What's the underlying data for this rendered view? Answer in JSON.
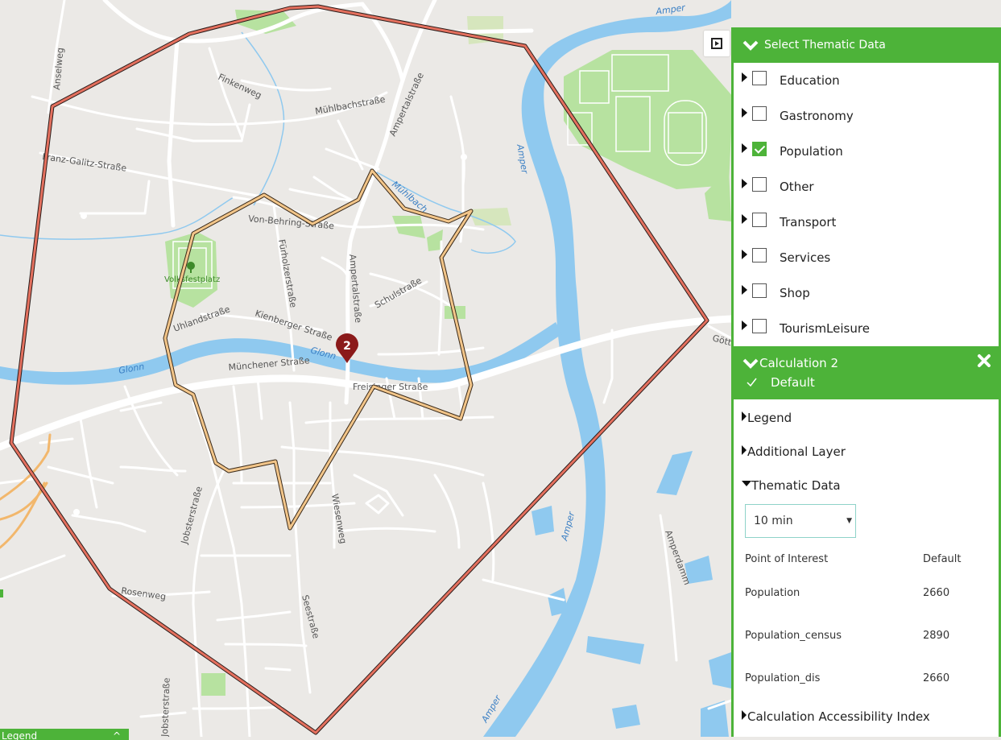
{
  "map": {
    "street_labels": [
      "Amper",
      "Anselweg",
      "Finkenweg",
      "Mühlbachstraße",
      "Ampertalstraße",
      "Franz-Galitz-Straße",
      "Mühlbach",
      "Von-Behring-Straße",
      "Fürholzerstraße",
      "Ampertalstraße",
      "Schulstraße",
      "Volksfestplatz",
      "Uhlandstraße",
      "Kienberger Straße",
      "Glonn",
      "Glonn",
      "Münchener Straße",
      "Freisinger Straße",
      "Göttschinger",
      "Amper",
      "Jobsterstraße",
      "Wiesenweg",
      "Rosenweg",
      "Seestraße",
      "Amperdamm",
      "Amper",
      "Jobsterstraße",
      "Amper"
    ],
    "marker_label": "2",
    "colors": {
      "outer_isochrone": "#e4705e",
      "inner_isochrone": "#f2c589",
      "marker": "#8b1a1a",
      "water": "#8fc9ef",
      "park": "#b7e2a0"
    }
  },
  "legend_tab": {
    "label": "Legend"
  },
  "panel": {
    "header": "Select Thematic Data",
    "layers": [
      {
        "label": "Education",
        "checked": false
      },
      {
        "label": "Gastronomy",
        "checked": false
      },
      {
        "label": "Population",
        "checked": true
      },
      {
        "label": "Other",
        "checked": false
      },
      {
        "label": "Transport",
        "checked": false
      },
      {
        "label": "Services",
        "checked": false
      },
      {
        "label": "Shop",
        "checked": false
      },
      {
        "label": "TourismLeisure",
        "checked": false
      }
    ],
    "calc": {
      "title": "Calculation 2",
      "default_label": "Default",
      "legend": "Legend",
      "additional_layer": "Additional Layer",
      "thematic_data": "Thematic Data",
      "time_select": "10 min",
      "table": {
        "headers": [
          "Point of Interest",
          "Default"
        ],
        "rows": [
          [
            "Population",
            "2660"
          ],
          [
            "Population_census",
            "2890"
          ],
          [
            "Population_dis",
            "2660"
          ]
        ]
      },
      "accessibility": "Calculation Accessibility Index"
    }
  }
}
